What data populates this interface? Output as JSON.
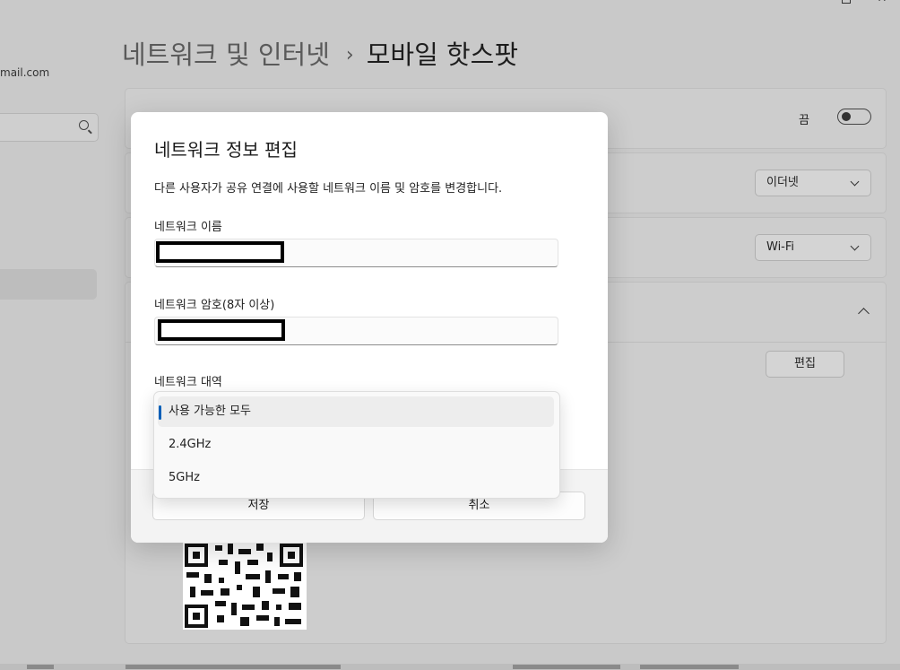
{
  "window": {
    "minimize_glyph": "—",
    "close_glyph": "✕"
  },
  "sidebar": {
    "account_email": "mail.com",
    "search_icon": "search-icon"
  },
  "header": {
    "breadcrumb_parent": "네트워크 및 인터넷",
    "breadcrumb_separator": "›",
    "breadcrumb_current": "모바일 핫스팟"
  },
  "settings": {
    "hotspot_toggle_label": "끔",
    "share_from_value": "이더넷",
    "share_over_value": "Wi-Fi",
    "edit_label": "편집"
  },
  "dialog": {
    "title": "네트워크 정보 편집",
    "description": "다른 사용자가 공유 연결에 사용할 네트워크 이름 및 암호를 변경합니다.",
    "name_label": "네트워크 이름",
    "name_value": "",
    "password_label": "네트워크 암호(8자 이상)",
    "password_value": "",
    "band_label": "네트워크 대역",
    "save_label": "저장",
    "cancel_label": "취소"
  },
  "band_dropdown": {
    "selected_index": 0,
    "options": [
      "사용 가능한 모두",
      "2.4GHz",
      "5GHz"
    ]
  },
  "colors": {
    "accent": "#005fb8",
    "overlay": "#c9c9c9",
    "dialog_bg": "#ffffff"
  }
}
